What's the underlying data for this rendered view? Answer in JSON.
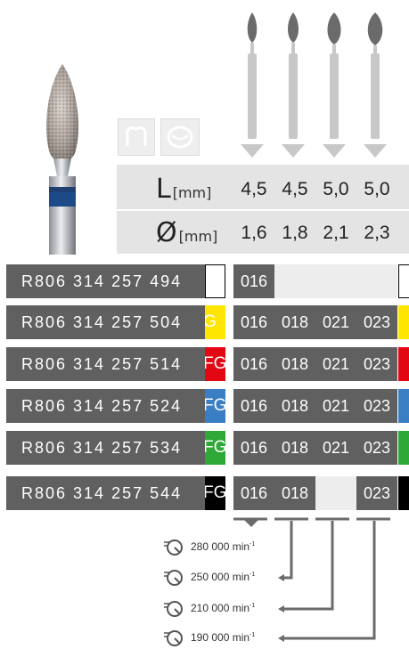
{
  "product_image": "diamond-bur-flame-blue-band",
  "shank_icons": [
    "tooth-crown-icon",
    "tooth-occlusal-icon"
  ],
  "tip_icons": [
    "bur-tip-icon-1",
    "bur-tip-icon-2",
    "bur-tip-icon-3",
    "bur-tip-icon-4"
  ],
  "specs": {
    "length": {
      "symbol": "L",
      "unit": "[mm]",
      "values": [
        "4,5",
        "4,5",
        "5,0",
        "5,0"
      ]
    },
    "diameter": {
      "symbol": "Ø",
      "unit": "[mm]",
      "values": [
        "1,6",
        "1,8",
        "2,1",
        "2,3"
      ]
    }
  },
  "rows": [
    {
      "code": "R806 314 257 494",
      "shank": "",
      "color": "#ffffff",
      "border": "#000000",
      "sizes": [
        "016",
        "",
        "",
        ""
      ]
    },
    {
      "code": "R806 314 257 504",
      "shank": "G",
      "color": "#ffe600",
      "border": "",
      "sizes": [
        "016",
        "018",
        "021",
        "023"
      ]
    },
    {
      "code": "R806 314 257 514",
      "shank": "FG",
      "color": "#e30613",
      "border": "",
      "sizes": [
        "016",
        "018",
        "021",
        "023"
      ]
    },
    {
      "code": "R806 314 257 524",
      "shank": "FG",
      "color": "#3a7ec4",
      "border": "",
      "sizes": [
        "016",
        "018",
        "021",
        "023"
      ]
    },
    {
      "code": "R806 314 257 534",
      "shank": "FG",
      "color": "#2ea836",
      "border": "",
      "sizes": [
        "016",
        "018",
        "021",
        "023"
      ]
    },
    {
      "code": "R806 314 257 544",
      "shank": "FG",
      "color": "#000000",
      "border": "",
      "sizes": [
        "016",
        "018",
        "",
        "023"
      ]
    }
  ],
  "speeds": [
    {
      "label": "280 000 min",
      "sup": "-1"
    },
    {
      "label": "250 000 min",
      "sup": "-1"
    },
    {
      "label": "210 000 min",
      "sup": "-1"
    },
    {
      "label": "190 000 min",
      "sup": "-1"
    }
  ],
  "speed_icon": "speed-dial-icon",
  "colors": {
    "cell": "#606060",
    "panel": "#e4e4e4",
    "empty": "#ededed",
    "arrow": "#6b6b6b",
    "instrument": "#c8c8c8"
  }
}
